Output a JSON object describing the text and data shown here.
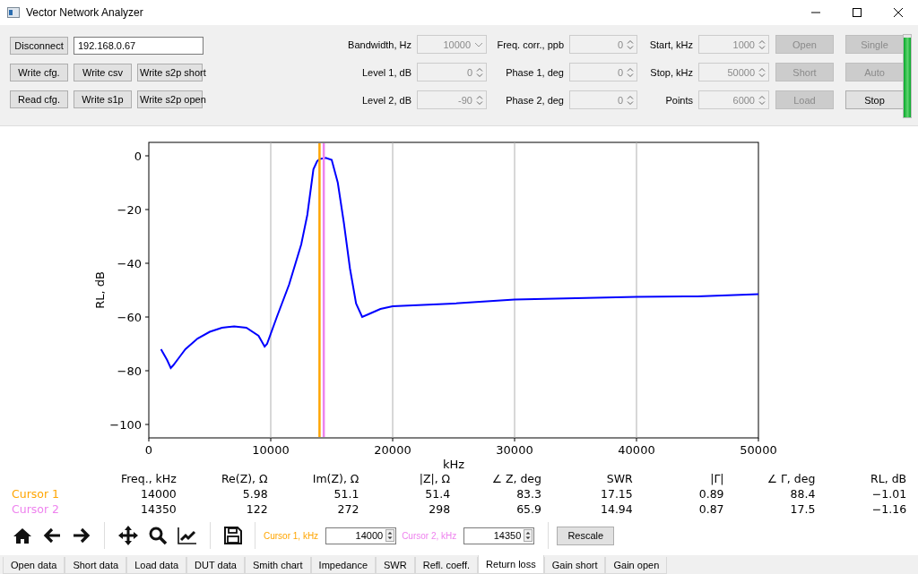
{
  "window": {
    "title": "Vector Network Analyzer"
  },
  "connect_button": {
    "label": "Disconnect"
  },
  "address_field": {
    "value": "192.168.0.67"
  },
  "file_buttons": [
    {
      "label": "Write cfg."
    },
    {
      "label": "Write csv"
    },
    {
      "label": "Write s2p short"
    },
    {
      "label": "Read cfg."
    },
    {
      "label": "Write s1p"
    },
    {
      "label": "Write s2p open"
    }
  ],
  "settings": [
    {
      "label": "Bandwidth, Hz",
      "value": "10000",
      "kind": "combo",
      "disabled": true
    },
    {
      "label": "Freq. corr., ppb",
      "value": "0",
      "kind": "spin",
      "disabled": true
    },
    {
      "label": "Start, kHz",
      "value": "1000",
      "kind": "spin",
      "disabled": true
    },
    {
      "label": "Level 1, dB",
      "value": "0",
      "kind": "spin",
      "disabled": true
    },
    {
      "label": "Phase 1, deg",
      "value": "0",
      "kind": "spin",
      "disabled": true
    },
    {
      "label": "Stop, kHz",
      "value": "50000",
      "kind": "spin",
      "disabled": true
    },
    {
      "label": "Level 2, dB",
      "value": "-90",
      "kind": "spin",
      "disabled": true
    },
    {
      "label": "Phase 2, deg",
      "value": "0",
      "kind": "spin",
      "disabled": true
    },
    {
      "label": "Points",
      "value": "6000",
      "kind": "spin",
      "disabled": true
    }
  ],
  "action_buttons": [
    {
      "label": "Open",
      "disabled": true
    },
    {
      "label": "Single",
      "disabled": true
    },
    {
      "label": "Short",
      "disabled": true
    },
    {
      "label": "Auto",
      "disabled": true
    },
    {
      "label": "Load",
      "disabled": true
    },
    {
      "label": "Stop",
      "disabled": false
    }
  ],
  "meter": {
    "level": 0.97
  },
  "plot": {
    "chart_data": {
      "type": "line",
      "xlabel": "kHz",
      "ylabel": "RL, dB",
      "x": [
        1000,
        1500,
        1800,
        2000,
        2500,
        3000,
        4000,
        5000,
        6000,
        7000,
        8000,
        9000,
        9500,
        9700,
        10500,
        11500,
        12500,
        13000,
        13500,
        13800,
        14000,
        14500,
        15000,
        15500,
        16000,
        16500,
        17000,
        17500,
        18000,
        19000,
        20000,
        25000,
        30000,
        35000,
        40000,
        45000,
        50000
      ],
      "series": [
        {
          "color": "#0000ff",
          "values": [
            -72,
            -76,
            -79,
            -78,
            -75,
            -72,
            -68,
            -65.5,
            -64,
            -63.5,
            -64,
            -67,
            -71,
            -70,
            -60,
            -48,
            -33,
            -22,
            -5,
            -2,
            -1.2,
            -0.8,
            -1.5,
            -10,
            -25,
            -42,
            -55,
            -60,
            -59,
            -57,
            -56,
            -55,
            -53.5,
            -53,
            -52.5,
            -52.3,
            -51.5
          ]
        }
      ],
      "xlim": [
        0,
        50000
      ],
      "ylim": [
        -105,
        5
      ],
      "xticks": [
        0,
        10000,
        20000,
        30000,
        40000,
        50000
      ],
      "yticks": [
        {
          "value": 0,
          "label": "0"
        },
        {
          "value": -20,
          "label": "−20"
        },
        {
          "value": -40,
          "label": "−40"
        },
        {
          "value": -60,
          "label": "−60"
        },
        {
          "value": -80,
          "label": "−80"
        },
        {
          "value": -100,
          "label": "−100"
        }
      ],
      "grid": true,
      "ref_lines": [
        {
          "axis": "x",
          "value": 14000,
          "color": "#ffa500"
        },
        {
          "axis": "x",
          "value": 14350,
          "color": "#ee82ee"
        }
      ]
    }
  },
  "cursor_table": {
    "columns": [
      "Freq., kHz",
      "Re(Z), Ω",
      "Im(Z), Ω",
      "|Z|, Ω",
      "∠ Z, deg",
      "SWR",
      "|Γ|",
      "∠ Γ, deg",
      "RL, dB"
    ],
    "rows": [
      {
        "label": "Cursor 1",
        "color": "#ffa500",
        "cells": [
          "14000",
          "5.98",
          "51.1",
          "51.4",
          "83.3",
          "17.15",
          "0.89",
          "88.4",
          "−1.01"
        ]
      },
      {
        "label": "Cursor 2",
        "color": "#ee82ee",
        "cells": [
          "14350",
          "122",
          "272",
          "298",
          "65.9",
          "14.94",
          "0.87",
          "17.5",
          "−1.16"
        ]
      }
    ]
  },
  "cursor_inputs": [
    {
      "label": "Cursor 1, kHz",
      "value": "14000",
      "color": "#ffa500"
    },
    {
      "label": "Cursor 2, kHz",
      "value": "14350",
      "color": "#ee82ee"
    }
  ],
  "rescale_button": {
    "label": "Rescale"
  },
  "tabs": [
    {
      "label": "Open data",
      "selected": false
    },
    {
      "label": "Short data",
      "selected": false
    },
    {
      "label": "Load data",
      "selected": false
    },
    {
      "label": "DUT data",
      "selected": false
    },
    {
      "label": "Smith chart",
      "selected": false
    },
    {
      "label": "Impedance",
      "selected": false
    },
    {
      "label": "SWR",
      "selected": false
    },
    {
      "label": "Refl. coeff.",
      "selected": false
    },
    {
      "label": "Return loss",
      "selected": true
    },
    {
      "label": "Gain short",
      "selected": false
    },
    {
      "label": "Gain open",
      "selected": false
    }
  ]
}
